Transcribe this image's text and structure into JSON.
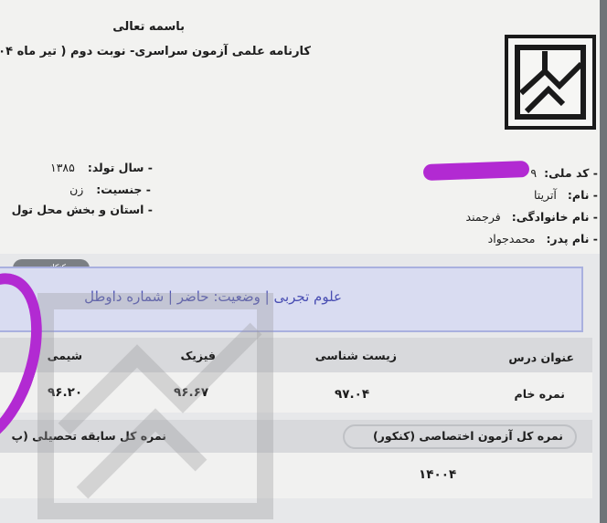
{
  "header": {
    "basmala": "باسمه تعالی",
    "title": "کارنامه علمی آزمون سراسری- نوبت دوم ( تیر ماه ۱۴۰۴"
  },
  "left_info": {
    "birth_year_label": "- سال تولد:",
    "birth_year": "۱۳۸۵",
    "gender_label": "- جنسیت:",
    "gender": "زن",
    "province_label": "- استان و بخش محل تول"
  },
  "right_info": {
    "national_code_label": "- کد ملی:",
    "national_code": "۹",
    "name_label": "- نام:",
    "name": "آتریتا",
    "family_label": "- نام خانوادگی:",
    "family": "فرجمند",
    "father_label": "- نام پدر:",
    "father": "محمدجواد"
  },
  "watermark_badge": "کنکاندوم",
  "status_line": "علوم تجربی | وضعیت: حاضر | شماره داوطل",
  "table": {
    "headers": [
      "عنوان درس",
      "زیست شناسی",
      "فیزیک",
      "شیمی"
    ],
    "row_label": "نمره خام",
    "values": [
      "۹۷.۰۴",
      "۹۶.۶۷",
      "۹۶.۲۰"
    ]
  },
  "totals": {
    "exam_total_label": "نمره کل آزمون اختصاصی (کنکور)",
    "academic_total_label": "نمره کل سابقه تحصیلی (پ",
    "exam_total_value": "۱۴۰۰۴"
  },
  "colors": {
    "highlight": "#b22ad2",
    "status_text": "#4a4fb3",
    "status_bg": "#d9dcf1"
  }
}
